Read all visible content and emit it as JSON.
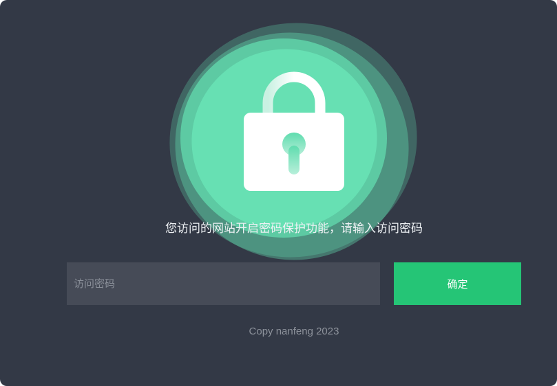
{
  "prompt": "您访问的网站开启密码保护功能，请输入访问密码",
  "password_input": {
    "placeholder": "访问密码",
    "value": ""
  },
  "confirm_button": {
    "label": "确定"
  },
  "footer": {
    "copyright": "Copy nanfeng 2023"
  },
  "colors": {
    "background": "#333946",
    "accent": "#25c576",
    "blob": "#64dcb0",
    "input_bg": "#464b57"
  },
  "icons": {
    "hero": "lock-icon"
  }
}
